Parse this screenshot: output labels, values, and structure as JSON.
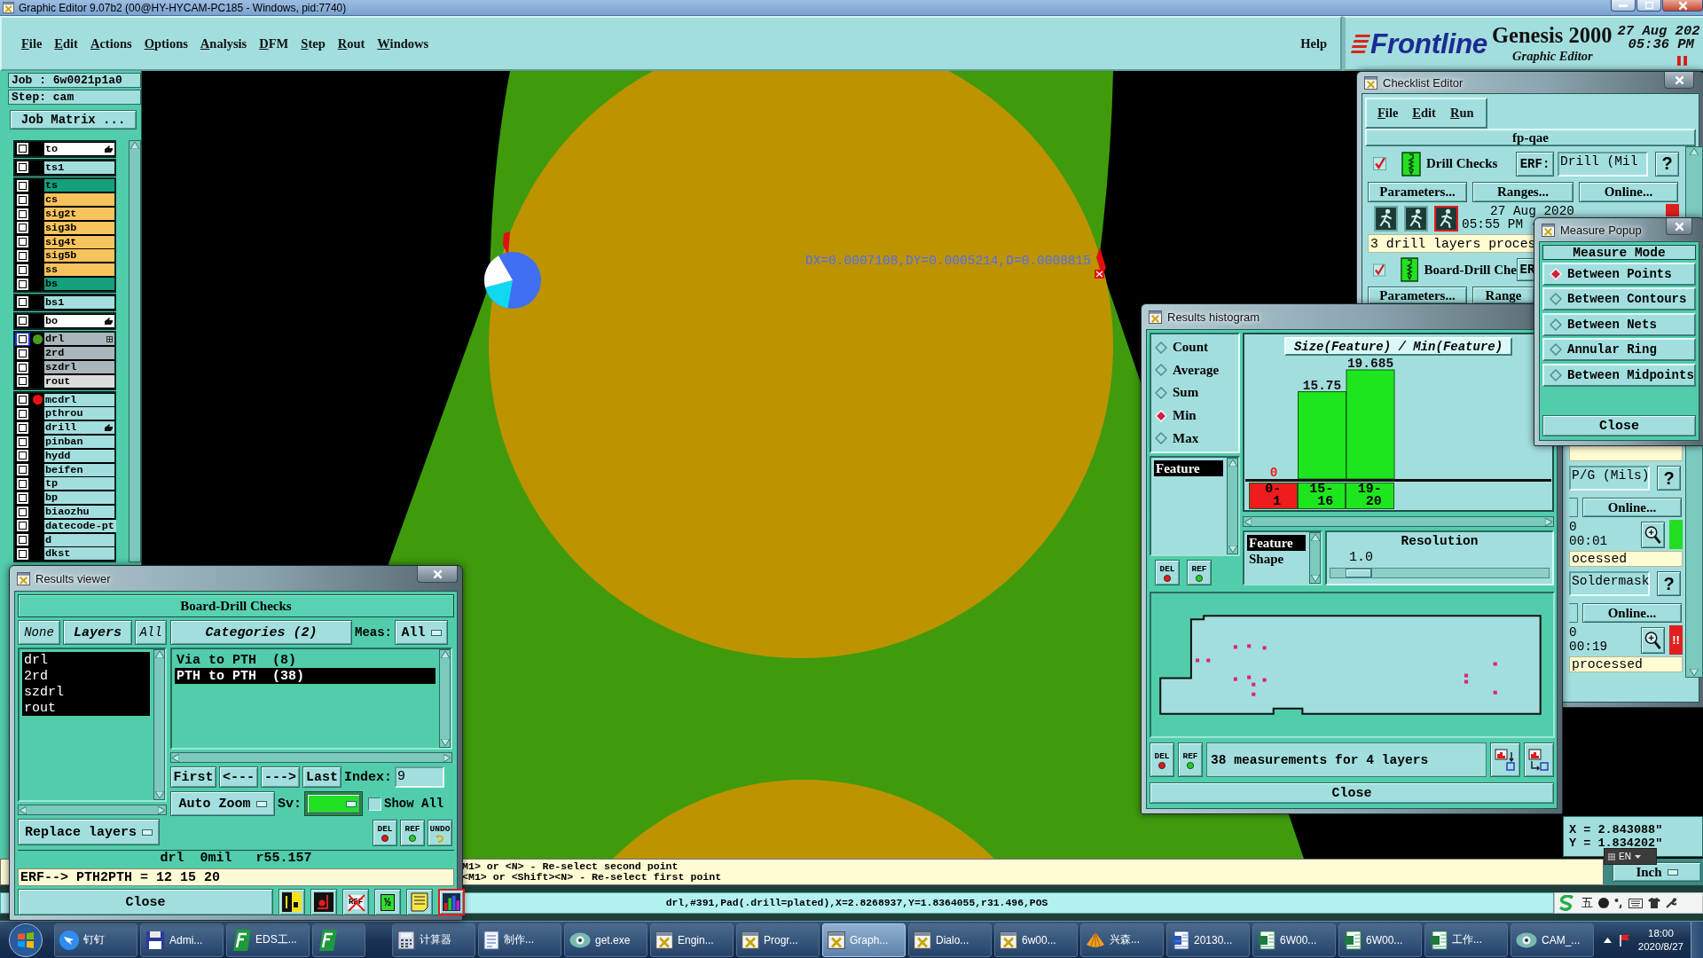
{
  "window": {
    "title": "Graphic Editor 9.07b2 (00@HY-HYCAM-PC185 - Windows, pid:7740)"
  },
  "menu": {
    "items": [
      "File",
      "Edit",
      "Actions",
      "Options",
      "Analysis",
      "DFM",
      "Step",
      "Rout",
      "Windows"
    ],
    "help": "Help"
  },
  "brand": {
    "logo": "Frontline",
    "product": "Genesis 2000",
    "subtitle": "Graphic Editor",
    "date": "27 Aug 202",
    "time": "05:36 PM"
  },
  "job_panel": {
    "job": "Job : 6w0021p1a0",
    "step": "Step: cam",
    "matrix_button": "Job Matrix ...",
    "layer_groups": [
      [
        {
          "name": "to",
          "color": "#ffffff",
          "checked": false,
          "selected": false,
          "kind": "hand"
        }
      ],
      [
        {
          "name": "ts1",
          "color": "#a3dede",
          "checked": false,
          "selected": false,
          "kind": "plain"
        }
      ],
      [
        {
          "name": "ts",
          "color": "#14a07c",
          "checked": false,
          "selected": false,
          "kind": "plain"
        },
        {
          "name": "cs",
          "color": "#f8c35c",
          "checked": false,
          "selected": false,
          "kind": "plain"
        },
        {
          "name": "sig2t",
          "color": "#f8c35c",
          "checked": false,
          "selected": false,
          "kind": "plain"
        },
        {
          "name": "sig3b",
          "color": "#f8c35c",
          "checked": false,
          "selected": false,
          "kind": "plain"
        },
        {
          "name": "sig4t",
          "color": "#f8c35c",
          "checked": false,
          "selected": false,
          "kind": "plain"
        },
        {
          "name": "sig5b",
          "color": "#f8c35c",
          "checked": false,
          "selected": false,
          "kind": "plain"
        },
        {
          "name": "ss",
          "color": "#f8c35c",
          "checked": false,
          "selected": false,
          "kind": "plain"
        },
        {
          "name": "bs",
          "color": "#14a07c",
          "checked": false,
          "selected": false,
          "kind": "plain"
        }
      ],
      [
        {
          "name": "bs1",
          "color": "#a3dede",
          "checked": false,
          "selected": false,
          "kind": "plain"
        }
      ],
      [
        {
          "name": "bo",
          "color": "#ffffff",
          "checked": false,
          "selected": false,
          "kind": "hand"
        }
      ],
      [
        {
          "name": "drl",
          "color": "#a9b6bb",
          "checked": false,
          "selected": true,
          "kind": "grid",
          "dot": {
            "color": "#4a9b1e"
          }
        },
        {
          "name": "2rd",
          "color": "#a9b6bb",
          "checked": false,
          "selected": false,
          "kind": "plain"
        },
        {
          "name": "szdrl",
          "color": "#a9b6bb",
          "checked": false,
          "selected": false,
          "kind": "plain"
        },
        {
          "name": "rout",
          "color": "#dcdcdc",
          "checked": false,
          "selected": false,
          "kind": "plain"
        }
      ],
      [
        {
          "name": "mcdrl",
          "color": "#a3dede",
          "checked": false,
          "selected": false,
          "kind": "plain",
          "dot": {
            "color": "#ee1111"
          }
        },
        {
          "name": "pthrou",
          "color": "#a3dede",
          "checked": false,
          "selected": false,
          "kind": "plain"
        },
        {
          "name": "drill",
          "color": "#a3dede",
          "checked": false,
          "selected": false,
          "kind": "hand"
        },
        {
          "name": "pinban",
          "color": "#a3dede",
          "checked": false,
          "selected": false,
          "kind": "plain"
        },
        {
          "name": "hydd",
          "color": "#a3dede",
          "checked": false,
          "selected": false,
          "kind": "plain"
        },
        {
          "name": "beifen",
          "color": "#a3dede",
          "checked": false,
          "selected": false,
          "kind": "plain"
        },
        {
          "name": "tp",
          "color": "#a3dede",
          "checked": false,
          "selected": false,
          "kind": "plain"
        },
        {
          "name": "bp",
          "color": "#a3dede",
          "checked": false,
          "selected": false,
          "kind": "plain"
        },
        {
          "name": "biaozhu",
          "color": "#a3dede",
          "checked": false,
          "selected": false,
          "kind": "plain"
        },
        {
          "name": "datecode-pt",
          "color": "#a3dede",
          "checked": false,
          "selected": false,
          "kind": "plain"
        },
        {
          "name": "d",
          "color": "#a3dede",
          "checked": false,
          "selected": false,
          "kind": "plain"
        },
        {
          "name": "dkst",
          "color": "#a3dede",
          "checked": false,
          "selected": false,
          "kind": "plain"
        }
      ]
    ]
  },
  "canvas": {
    "measurement": "DX=0.0007108,DY=0.0005214,D=0.0008815"
  },
  "coordinates": {
    "x": "X = 2.843088\"",
    "y": "Y = 1.834202\""
  },
  "input_language": "EN",
  "prompt": {
    "lines": [
      "M1> or <N> - Re-select second point",
      "<M1> or <Shift><N> - Re-select first point"
    ],
    "units": "Inch"
  },
  "status_bar": {
    "text": "drl,#391,Pad(.drill=plated),X=2.8268937,Y=1.8364055,r31.496,POS",
    "ime_mode": "五"
  },
  "results_viewer": {
    "title": "Results viewer",
    "check": "Board-Drill Checks",
    "layer_buttons": {
      "none": "None",
      "title": "Layers",
      "all": "All"
    },
    "layers": [
      {
        "name": "drl",
        "selected": true
      },
      {
        "name": "2rd",
        "selected": true
      },
      {
        "name": "szdrl",
        "selected": true
      },
      {
        "name": "rout",
        "selected": true
      }
    ],
    "layer_mode": "Replace layers",
    "categories_button": "Categories (2)",
    "meas_label": "Meas:",
    "meas_value": "All",
    "categories": [
      {
        "label": "Via to PTH  (8)",
        "selected": false
      },
      {
        "label": "PTH to PTH  (38)",
        "selected": true
      }
    ],
    "nav": [
      "First",
      "<---",
      "--->",
      "Last"
    ],
    "index_label": "Index:",
    "index_value": "9",
    "zoom_mode": "Auto Zoom",
    "sv_label": "Sv:",
    "sv_field": {
      "color": "#22e022"
    },
    "show_all": {
      "label": "Show All",
      "checked": false
    },
    "edit_buttons": [
      {
        "kind": "delete",
        "label": "DEL"
      },
      {
        "kind": "reference",
        "label": "REF"
      },
      {
        "kind": "undo",
        "label": "UNDO"
      }
    ],
    "info": "drl  0mil   r55.157",
    "erf": "ERF--> PTH2PTH = 12 15 20",
    "close": "Close",
    "tools": [
      {
        "kind": "split",
        "selected": false
      },
      {
        "kind": "marker",
        "selected": false
      },
      {
        "kind": "crossed",
        "label": "REF",
        "selected": false
      },
      {
        "kind": "fraction",
        "label": "½",
        "selected": false
      },
      {
        "kind": "note",
        "selected": false
      },
      {
        "kind": "bars",
        "selected": true
      }
    ]
  },
  "histogram": {
    "title": "Results histogram",
    "modes": [
      {
        "label": "Count",
        "selected": false
      },
      {
        "label": "Average",
        "selected": false
      },
      {
        "label": "Sum",
        "selected": false
      },
      {
        "label": "Min",
        "selected": true
      },
      {
        "label": "Max",
        "selected": false
      }
    ],
    "groups": [
      {
        "label": "Feature",
        "selected": true
      }
    ],
    "edit_buttons": [
      {
        "kind": "delete",
        "label": "DEL"
      },
      {
        "kind": "reference",
        "label": "REF"
      }
    ],
    "chart_data": {
      "type": "bar",
      "title": "Size(Feature) / Min(Feature)",
      "categories": [
        "0-1",
        "15-16",
        "19-20"
      ],
      "values": [
        0,
        15.75,
        19.685
      ],
      "data_labels": true
    },
    "bins": [
      {
        "color": "#ee1c1c"
      },
      {
        "color": "#1ee61e"
      },
      {
        "color": "#1ee61e"
      }
    ],
    "attributes": [
      {
        "label": "Feature",
        "selected": true
      },
      {
        "label": "Shape",
        "selected": false
      }
    ],
    "resolution": {
      "label": "Resolution",
      "value": "1.0",
      "level": 0.08
    },
    "footer_buttons": [
      {
        "kind": "delete",
        "label": "DEL"
      },
      {
        "kind": "reference",
        "label": "REF"
      }
    ],
    "summary": "38 measurements for 4 layers",
    "close": "Close"
  },
  "checklist": {
    "title": "Checklist Editor",
    "menu": [
      "File",
      "Edit",
      "Run"
    ],
    "name": "fp-qae",
    "checks": [
      {
        "checked": true,
        "name": "Drill Checks",
        "erf_label": "ERF:",
        "erf_value": "Drill (Mil",
        "help": "?",
        "buttons": [
          "Parameters...",
          "Ranges...",
          "Online..."
        ],
        "date": "27 Aug 2020",
        "time": "05:55 PM -",
        "status": {
          "color": "#e0201c"
        },
        "message": "3 drill layers proces"
      },
      {
        "checked": true,
        "name": "Board-Drill Che",
        "erf_label": "ER",
        "buttons": [
          "Parameters...",
          "Range"
        ]
      }
    ],
    "covered_checks": [
      {
        "erf_value": "P/G (Mils)",
        "help": "?",
        "button": "Online...",
        "date": "0",
        "time": "00:01",
        "status": {
          "color": "#22dd22"
        },
        "message": "ocessed"
      },
      {
        "erf_value": "Soldermask",
        "help": "?",
        "button": "Online...",
        "date": "0",
        "time": "00:19",
        "status": {
          "color": "#e0201c",
          "text": "!!"
        },
        "message": "processed"
      }
    ]
  },
  "measure_popup": {
    "title": "Measure Popup",
    "heading": "Measure Mode",
    "modes": [
      {
        "label": "Between Points",
        "selected": true
      },
      {
        "label": "Between Contours",
        "selected": false
      },
      {
        "label": "Between Nets",
        "selected": false
      },
      {
        "label": "Annular Ring",
        "selected": false
      },
      {
        "label": "Between Midpoints",
        "selected": false
      }
    ],
    "close": "Close"
  },
  "taskbar": {
    "items": [
      {
        "kind": "bird",
        "label": "钉钉",
        "selected": false
      },
      {
        "kind": "floppy",
        "label": "Admi...",
        "selected": false
      },
      {
        "kind": "logo-f",
        "label": "EDS工...",
        "selected": false
      },
      {
        "kind": "logo-f",
        "selected": false
      },
      {
        "kind": "calculator",
        "label": "计算器",
        "selected": false
      },
      {
        "kind": "document",
        "label": "制作...",
        "selected": false
      },
      {
        "kind": "eye",
        "label": "get.exe",
        "selected": false
      },
      {
        "kind": "x-window",
        "label": "Engin...",
        "selected": false
      },
      {
        "kind": "x-window",
        "label": "Progr...",
        "selected": false
      },
      {
        "kind": "x-window",
        "label": "Graph...",
        "selected": true
      },
      {
        "kind": "x-window",
        "label": "Dialo...",
        "selected": false
      },
      {
        "kind": "x-window",
        "label": "6w00...",
        "selected": false
      },
      {
        "kind": "shell",
        "label": "兴森...",
        "selected": false
      },
      {
        "kind": "word",
        "label": "20130...",
        "selected": false
      },
      {
        "kind": "sheet",
        "label": "6W00...",
        "selected": false
      },
      {
        "kind": "sheet",
        "label": "6W00...",
        "selected": false
      },
      {
        "kind": "sheet",
        "label": "工作...",
        "selected": false
      },
      {
        "kind": "eye",
        "label": "CAM_...",
        "selected": false
      }
    ],
    "clock": {
      "time": "18:00",
      "date": "2020/8/27"
    }
  }
}
